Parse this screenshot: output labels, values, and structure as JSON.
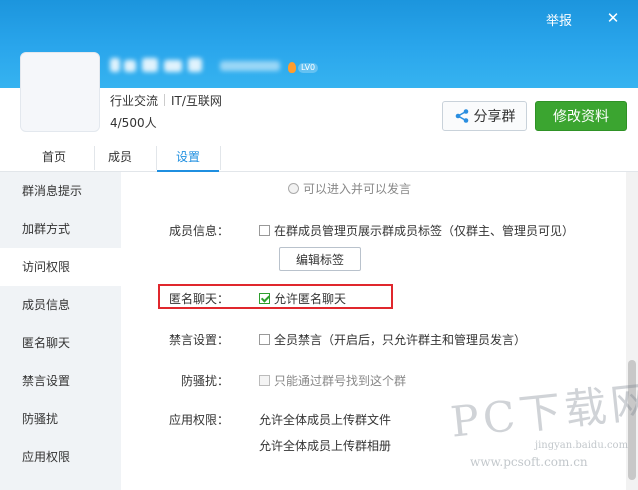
{
  "titlebar": {
    "report": "举报",
    "close": "✕"
  },
  "group": {
    "level_badge": "LV0",
    "category": [
      "行业交流",
      "IT/互联网"
    ],
    "members": "4/500人"
  },
  "actions": {
    "share": "分享群",
    "edit": "修改资料"
  },
  "tabs": [
    {
      "label": "首页"
    },
    {
      "label": "成员"
    },
    {
      "label": "设置"
    }
  ],
  "sidebar": [
    "群消息提示",
    "加群方式",
    "访问权限",
    "成员信息",
    "匿名聊天",
    "禁言设置",
    "防骚扰",
    "应用权限"
  ],
  "settings": {
    "join_option": "可以进入并可以发言",
    "member_info": {
      "label": "成员信息：",
      "option": "在群成员管理页展示群成员标签（仅群主、管理员可见）",
      "edit_button": "编辑标签"
    },
    "anonymous": {
      "label": "匿名聊天：",
      "option": "允许匿名聊天",
      "checked": true
    },
    "mute": {
      "label": "禁言设置：",
      "option": "全员禁言（开启后，只允许群主和管理员发言）"
    },
    "anti_spam": {
      "label": "防骚扰：",
      "option": "只能通过群号找到这个群"
    },
    "app_perm": {
      "label": "应用权限：",
      "options": [
        "允许全体成员上传群文件",
        "允许全体成员上传群相册"
      ]
    }
  },
  "watermark": {
    "main": "PC下载网",
    "url": "www.pcsoft.com.cn",
    "baidu": "jingyan.baidu.com"
  },
  "colors": {
    "header": "#2aa6ec",
    "accent": "#1f8fe0",
    "edit_button": "#3ba530",
    "highlight": "#e0272d"
  }
}
